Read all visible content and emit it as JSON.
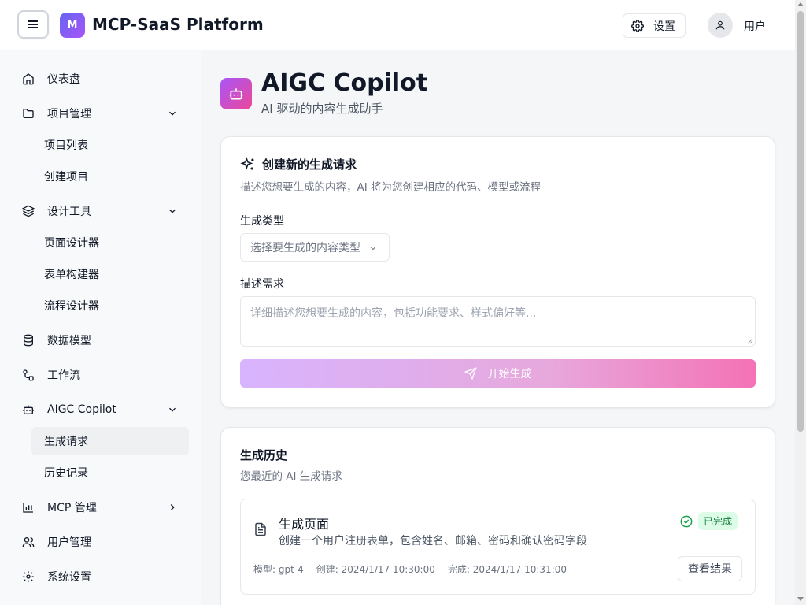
{
  "header": {
    "logo_letter": "M",
    "app_title": "MCP-SaaS Platform",
    "settings_label": "设置",
    "user_label": "用户"
  },
  "sidebar": {
    "items": [
      {
        "label": "仪表盘",
        "icon": "home-icon"
      },
      {
        "label": "项目管理",
        "icon": "folder-icon",
        "expanded": true,
        "children": [
          "项目列表",
          "创建项目"
        ]
      },
      {
        "label": "设计工具",
        "icon": "layers-icon",
        "expanded": true,
        "children": [
          "页面设计器",
          "表单构建器",
          "流程设计器"
        ]
      },
      {
        "label": "数据模型",
        "icon": "database-icon"
      },
      {
        "label": "工作流",
        "icon": "workflow-icon"
      },
      {
        "label": "AIGC Copilot",
        "icon": "bot-icon",
        "expanded": true,
        "children": [
          "生成请求",
          "历史记录"
        ],
        "active_child": "生成请求"
      },
      {
        "label": "MCP 管理",
        "icon": "bar-chart-icon",
        "expanded": false
      },
      {
        "label": "用户管理",
        "icon": "users-icon"
      },
      {
        "label": "系统设置",
        "icon": "gear-icon"
      }
    ]
  },
  "page": {
    "title": "AIGC Copilot",
    "subtitle": "AI 驱动的内容生成助手"
  },
  "create_card": {
    "title": "创建新的生成请求",
    "description": "描述您想要生成的内容，AI 将为您创建相应的代码、模型或流程",
    "type_label": "生成类型",
    "type_placeholder": "选择要生成的内容类型",
    "desc_label": "描述需求",
    "desc_placeholder": "详细描述您想要生成的内容，包括功能要求、样式偏好等...",
    "submit_label": "开始生成"
  },
  "history_card": {
    "title": "生成历史",
    "description": "您最近的 AI 生成请求",
    "items": [
      {
        "title": "生成页面",
        "description": "创建一个用户注册表单，包含姓名、邮箱、密码和确认密码字段",
        "status": "已完成",
        "model": "模型: gpt-4",
        "created": "创建: 2024/1/17 10:30:00",
        "completed": "完成: 2024/1/17 10:31:00",
        "view_label": "查看结果"
      }
    ]
  },
  "colors": {
    "accent_start": "#6366f1",
    "accent_end": "#a855f7",
    "success": "#15803d",
    "button_gradient_start": "#d8b4fe",
    "button_gradient_end": "#f472b6"
  }
}
